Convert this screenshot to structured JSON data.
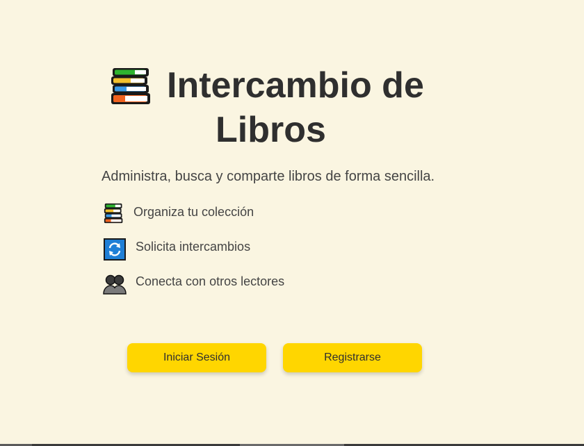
{
  "hero": {
    "title_line1": "Intercambio de",
    "title_line2": "Libros",
    "title_icon": "books-icon",
    "subtitle": "Administra, busca y comparte libros de forma sencilla."
  },
  "features": [
    {
      "icon": "books-icon",
      "label": "Organiza tu colección"
    },
    {
      "icon": "arrows-counterclockwise-icon",
      "label": "Solicita intercambios"
    },
    {
      "icon": "people-silhouette-icon",
      "label": "Conecta con otros lectores"
    }
  ],
  "buttons": {
    "login": "Iniciar Sesión",
    "register": "Registrarse"
  },
  "colors": {
    "background": "#faf5e1",
    "accent": "#ffd600",
    "text": "#2f2f2f"
  }
}
